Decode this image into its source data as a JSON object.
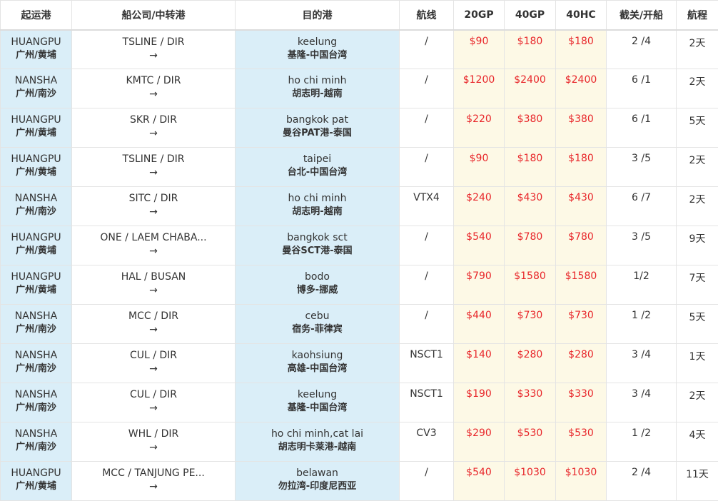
{
  "headers": {
    "origin": "起运港",
    "carrier": "船公司/中转港",
    "destination": "目的港",
    "route": "航线",
    "gp20": "20GP",
    "gp40": "40GP",
    "hc40": "40HC",
    "cutoff": "截关/开船",
    "transit": "航程"
  },
  "arrow": "→",
  "rows": [
    {
      "origin_en": "HUANGPU",
      "origin_cn": "广州/黄埔",
      "carrier": "TSLINE / DIR",
      "dest_en": "keelung",
      "dest_cn": "基隆-中国台湾",
      "route": "/",
      "gp20": "$90",
      "gp40": "$180",
      "hc40": "$180",
      "cutoff": "2 /4",
      "transit": "2天"
    },
    {
      "origin_en": "NANSHA",
      "origin_cn": "广州/南沙",
      "carrier": "KMTC / DIR",
      "dest_en": "ho chi minh",
      "dest_cn": "胡志明-越南",
      "route": "/",
      "gp20": "$1200",
      "gp40": "$2400",
      "hc40": "$2400",
      "cutoff": "6 /1",
      "transit": "2天"
    },
    {
      "origin_en": "HUANGPU",
      "origin_cn": "广州/黄埔",
      "carrier": "SKR / DIR",
      "dest_en": "bangkok pat",
      "dest_cn": "曼谷PAT港-泰国",
      "route": "/",
      "gp20": "$220",
      "gp40": "$380",
      "hc40": "$380",
      "cutoff": "6 /1",
      "transit": "5天"
    },
    {
      "origin_en": "HUANGPU",
      "origin_cn": "广州/黄埔",
      "carrier": "TSLINE / DIR",
      "dest_en": "taipei",
      "dest_cn": "台北-中国台湾",
      "route": "/",
      "gp20": "$90",
      "gp40": "$180",
      "hc40": "$180",
      "cutoff": "3 /5",
      "transit": "2天"
    },
    {
      "origin_en": "NANSHA",
      "origin_cn": "广州/南沙",
      "carrier": "SITC / DIR",
      "dest_en": "ho chi minh",
      "dest_cn": "胡志明-越南",
      "route": "VTX4",
      "gp20": "$240",
      "gp40": "$430",
      "hc40": "$430",
      "cutoff": "6 /7",
      "transit": "2天"
    },
    {
      "origin_en": "HUANGPU",
      "origin_cn": "广州/黄埔",
      "carrier": "ONE / LAEM CHABA...",
      "dest_en": "bangkok sct",
      "dest_cn": "曼谷SCT港-泰国",
      "route": "/",
      "gp20": "$540",
      "gp40": "$780",
      "hc40": "$780",
      "cutoff": "3 /5",
      "transit": "9天"
    },
    {
      "origin_en": "HUANGPU",
      "origin_cn": "广州/黄埔",
      "carrier": "HAL / BUSAN",
      "dest_en": "bodo",
      "dest_cn": "博多-挪威",
      "route": "/",
      "gp20": "$790",
      "gp40": "$1580",
      "hc40": "$1580",
      "cutoff": "1/2",
      "transit": "7天"
    },
    {
      "origin_en": "NANSHA",
      "origin_cn": "广州/南沙",
      "carrier": "MCC / DIR",
      "dest_en": "cebu",
      "dest_cn": "宿务-菲律宾",
      "route": "/",
      "gp20": "$440",
      "gp40": "$730",
      "hc40": "$730",
      "cutoff": "1 /2",
      "transit": "5天"
    },
    {
      "origin_en": "NANSHA",
      "origin_cn": "广州/南沙",
      "carrier": "CUL / DIR",
      "dest_en": "kaohsiung",
      "dest_cn": "高雄-中国台湾",
      "route": "NSCT1",
      "gp20": "$140",
      "gp40": "$280",
      "hc40": "$280",
      "cutoff": "3 /4",
      "transit": "1天"
    },
    {
      "origin_en": "NANSHA",
      "origin_cn": "广州/南沙",
      "carrier": "CUL / DIR",
      "dest_en": "keelung",
      "dest_cn": "基隆-中国台湾",
      "route": "NSCT1",
      "gp20": "$190",
      "gp40": "$330",
      "hc40": "$330",
      "cutoff": "3 /4",
      "transit": "2天"
    },
    {
      "origin_en": "NANSHA",
      "origin_cn": "广州/南沙",
      "carrier": "WHL / DIR",
      "dest_en": "ho chi minh,cat lai",
      "dest_cn": "胡志明卡莱港-越南",
      "route": "CV3",
      "gp20": "$290",
      "gp40": "$530",
      "hc40": "$530",
      "cutoff": "1 /2",
      "transit": "4天"
    },
    {
      "origin_en": "HUANGPU",
      "origin_cn": "广州/黄埔",
      "carrier": "MCC / TANJUNG PE...",
      "dest_en": "belawan",
      "dest_cn": "勿拉湾-印度尼西亚",
      "route": "/",
      "gp20": "$540",
      "gp40": "$1030",
      "hc40": "$1030",
      "cutoff": "2 /4",
      "transit": "11天"
    }
  ]
}
